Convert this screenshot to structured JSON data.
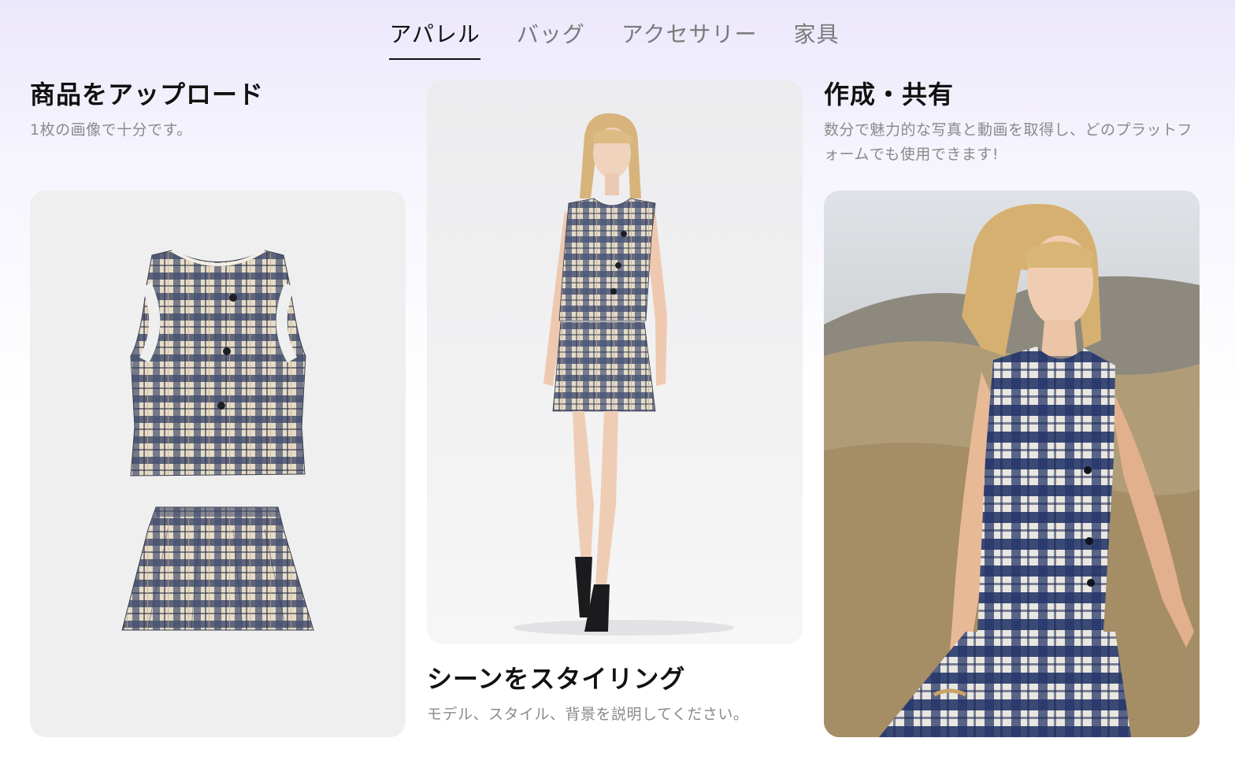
{
  "tabs": [
    {
      "label": "アパレル",
      "active": true
    },
    {
      "label": "バッグ",
      "active": false
    },
    {
      "label": "アクセサリー",
      "active": false
    },
    {
      "label": "家具",
      "active": false
    }
  ],
  "steps": [
    {
      "title": "商品をアップロード",
      "description": "1枚の画像で十分です。"
    },
    {
      "title": "シーンをスタイリング",
      "description": "モデル、スタイル、背景を説明してください。"
    },
    {
      "title": "作成・共有",
      "description": "数分で魅力的な写真と動画を取得し、どのプラットフォームでも使用できます!"
    }
  ],
  "colors": {
    "active_tab": "#111111",
    "inactive_tab": "#7a7a7a",
    "description": "#8a8a8a",
    "plaid_navy": "#3e4a6a",
    "plaid_cream": "#e9e1cf"
  }
}
